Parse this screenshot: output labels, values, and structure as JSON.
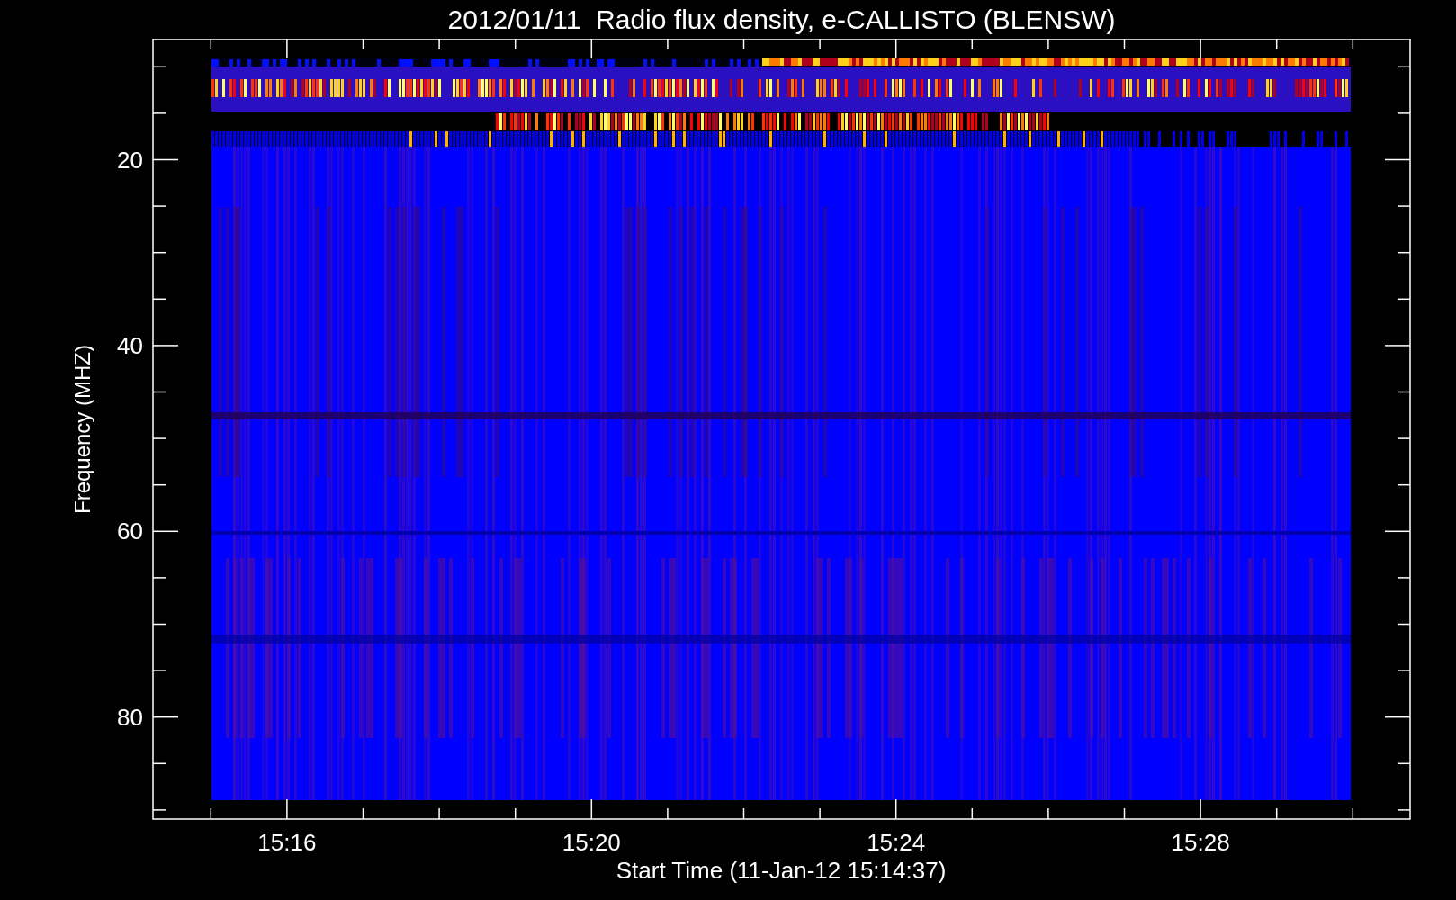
{
  "title": "2012/01/11  Radio flux density, e-CALLISTO (BLENSW)",
  "plot": {
    "ylabel": "Frequency (MHZ)",
    "xlabel": "Start Time (11-Jan-12 15:14:37)",
    "xticks": [
      "15:16",
      "15:20",
      "15:24",
      "15:28"
    ],
    "yticks": [
      "20",
      "40",
      "60",
      "80"
    ]
  }
}
